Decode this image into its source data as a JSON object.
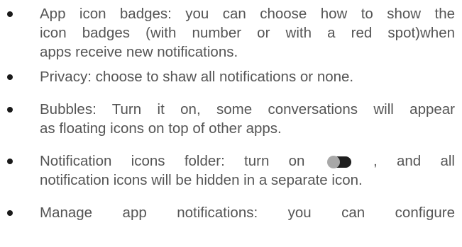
{
  "items": [
    {
      "lines": [
        "App icon badges: you can choose how to show the",
        "icon badges (with number or with a red spot)when",
        "apps receive new notifications."
      ]
    },
    {
      "lines": [
        "Privacy: choose to shaw all notifications or none."
      ]
    },
    {
      "lines": [
        "Bubbles: Turn it on, some conversations will appear",
        "as floating icons on top of other apps."
      ]
    },
    {
      "line1_before_toggle": "Notification icons folder: turn on",
      "line1_after_toggle": ", and all",
      "line2": "notification icons will be hidden in a separate icon.",
      "toggle_icon": "toggle-switch-icon"
    },
    {
      "lines": [
        "Manage app notifications: you can configure"
      ]
    }
  ]
}
